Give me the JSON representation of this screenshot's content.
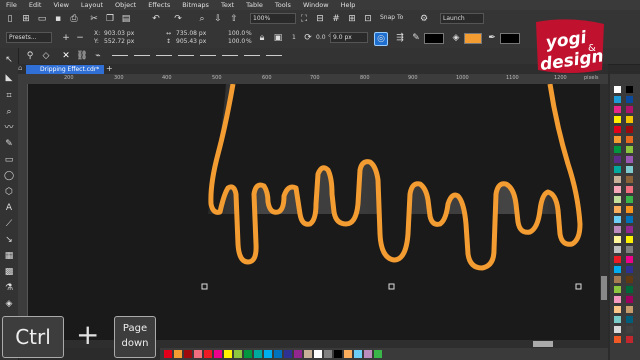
{
  "menu": [
    "File",
    "Edit",
    "View",
    "Layout",
    "Object",
    "Effects",
    "Bitmaps",
    "Text",
    "Table",
    "Tools",
    "Window",
    "Help"
  ],
  "toolbar": {
    "zoom": "100%",
    "snap_to": "Snap To",
    "launch": "Launch"
  },
  "property_bar": {
    "presets": "Presets...",
    "x": "903.03 px",
    "y": "552.72 px",
    "w": "735.08 px",
    "h": "905.43 px",
    "pct_w": "100.0",
    "pct_h": "100.0",
    "percent": "%",
    "outline_width": "9.0 px",
    "count": "1",
    "angle": "0.0",
    "angle_unit": "°",
    "fill_color": "#f39c32",
    "outline_color": "#000000"
  },
  "document_tab": "Dripping Effect.cdr*",
  "ruler_marks": [
    "200",
    "300",
    "400",
    "500",
    "600",
    "700",
    "800",
    "900",
    "1000",
    "1100",
    "1200",
    "pixels"
  ],
  "keys": {
    "ctrl": "Ctrl",
    "plus": "+",
    "page": "Page",
    "down": "down"
  },
  "logo": {
    "line1": "yogi",
    "line2": "design",
    "amp": "&"
  },
  "colors": {
    "accent": "#f39c32",
    "tab": "#2f6fd6",
    "canvas": "#1a1a1a"
  }
}
